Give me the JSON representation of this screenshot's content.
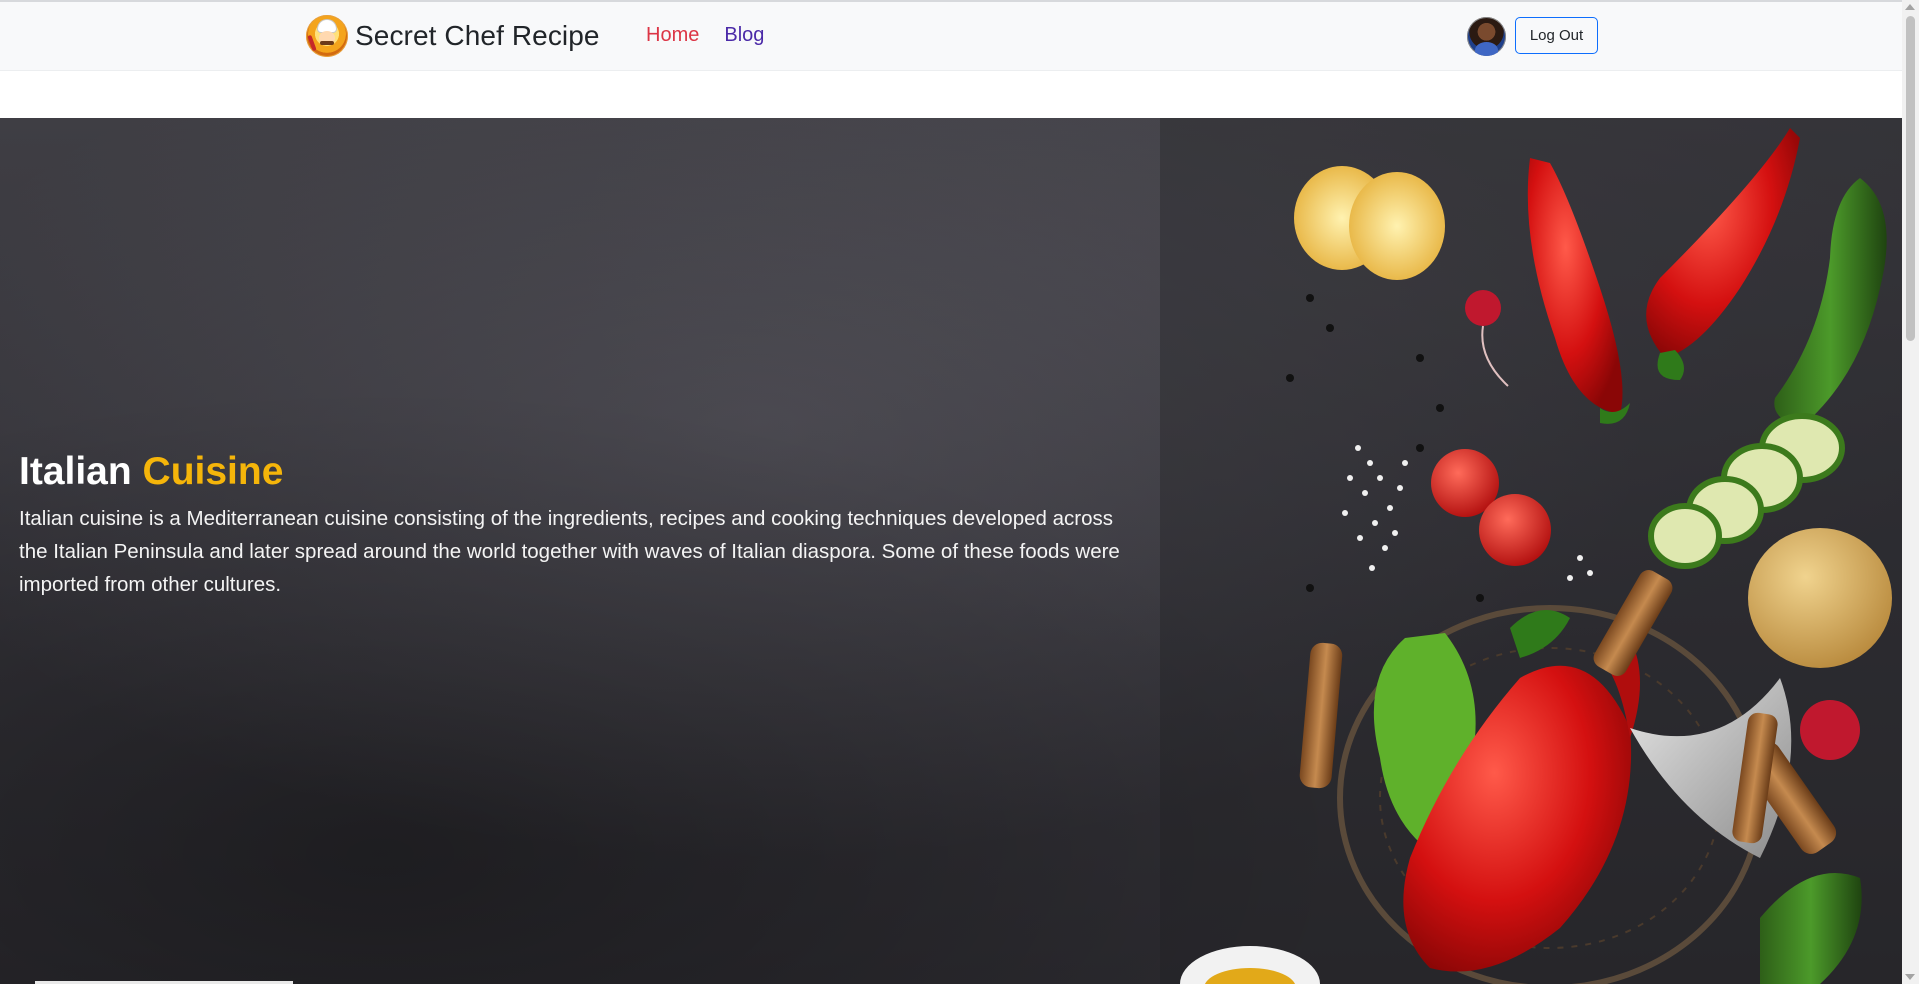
{
  "navbar": {
    "brand_name": "Secret Chef Recipe",
    "links": [
      {
        "label": "Home",
        "active": true,
        "color": "#dc3545"
      },
      {
        "label": "Blog",
        "active": false,
        "color": "#4b2aa8"
      }
    ],
    "logout_label": "Log Out"
  },
  "hero": {
    "title_part1": "Italian",
    "title_part2": "Cuisine",
    "title_accent_color": "#f5b50a",
    "description": "Italian cuisine is a Mediterranean cuisine consisting of the ingredients, recipes and cooking techniques developed across the Italian Peninsula and later spread around the world together with waves of Italian diaspora. Some of these foods were imported from other cultures."
  },
  "icons": {
    "brand_logo": "chef-logo-icon",
    "avatar": "user-avatar"
  }
}
